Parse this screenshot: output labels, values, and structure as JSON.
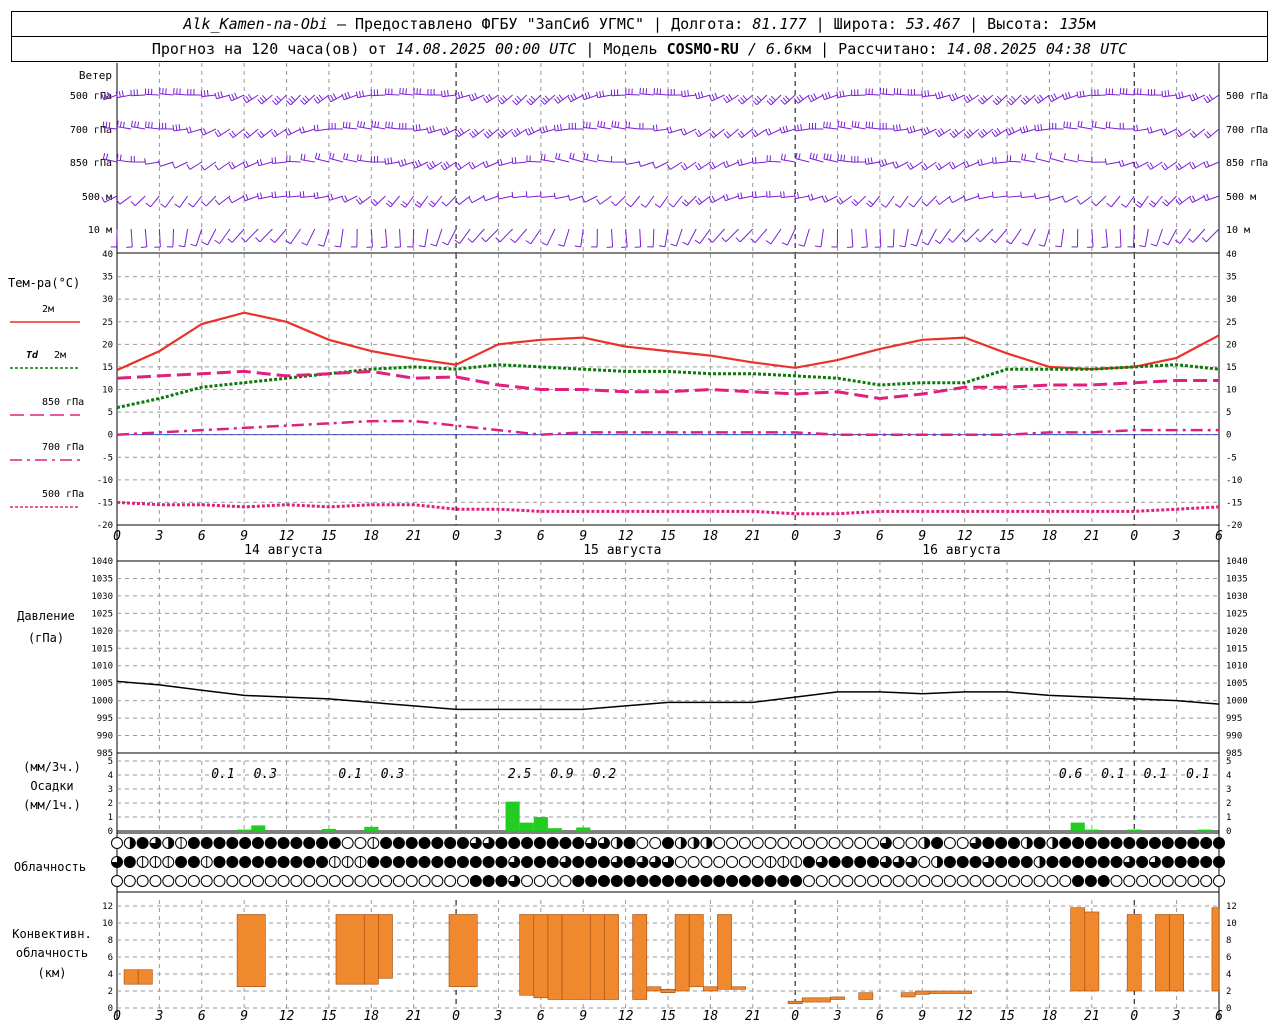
{
  "header": {
    "station": "Alk_Kamen-na-Obi",
    "provider": "– Предоставлено ФГБУ \"ЗапСиб УГМС\" |",
    "lon_label": "Долгота:",
    "lon": "81.177",
    "lat_label": "| Широта:",
    "lat": "53.467",
    "alt_label": "| Высота:",
    "alt": "135",
    "alt_unit": "м",
    "fc_label": "Прогноз на 120 часа(ов) от",
    "fc_start": "14.08.2025 00:00 UTC",
    "model_label": "| Модель",
    "model": "COSMO-RU",
    "model_res": "/ 6.6",
    "model_res_unit": "км",
    "calc_label": "| Рассчитано:",
    "calc_time": "14.08.2025 04:38 UTC"
  },
  "labels": {
    "wind": "Ветер",
    "wind_levels": [
      "500 гПа",
      "700 гПа",
      "850 гПа",
      "500 м",
      "10  м"
    ],
    "temp_title": "Тем-ра(°C)",
    "temp_2m": "2м",
    "td": "Td",
    "td_2m": "2м",
    "t850": "850 гПа",
    "t700": "700 гПа",
    "t500": "500 гПа",
    "pressure": "Давление",
    "pressure_unit": "(гПа)",
    "precip_unit3": "(мм/3ч.)",
    "precip": "Осадки",
    "precip_unit1": "(мм/1ч.)",
    "cloud": "Облачность",
    "conv1": "Конвективн.",
    "conv2": "облачность",
    "conv3": "(км)"
  },
  "colors": {
    "t2m": "#e8322a",
    "td": "#0a7a0a",
    "t850": "#e0207c",
    "wind": "#7a1fd6",
    "precip": "#22cc22",
    "conv": "#f0882e",
    "grid": "#999999"
  },
  "chart_data": [
    {
      "type": "line",
      "title": "Температура",
      "x_ticks": [
        "0",
        "3",
        "6",
        "9",
        "12",
        "15",
        "18",
        "21",
        "0",
        "3",
        "6",
        "9",
        "12",
        "15",
        "18",
        "21",
        "0",
        "3",
        "6",
        "9",
        "12",
        "15",
        "18",
        "21",
        "0",
        "3",
        "6"
      ],
      "day_labels": [
        "14 августа",
        "15 августа",
        "16 августа"
      ],
      "ylim": [
        -20,
        40
      ],
      "yticks": [
        "-20",
        "-15",
        "-10",
        "-5",
        "0",
        "5",
        "10",
        "15",
        "20",
        "25",
        "30",
        "35",
        "40"
      ],
      "x_hours": [
        0,
        3,
        6,
        9,
        12,
        15,
        18,
        21,
        24,
        27,
        30,
        33,
        36,
        39,
        42,
        45,
        48,
        51,
        54,
        57,
        60,
        63,
        66,
        69,
        72,
        75,
        78
      ],
      "series": [
        {
          "name": "2м",
          "key": "t2m",
          "values": [
            14.3,
            18.5,
            24.5,
            27,
            25,
            21,
            18.5,
            16.8,
            15.5,
            20,
            21,
            21.5,
            19.5,
            18.5,
            17.5,
            16,
            14.8,
            16.5,
            19,
            21,
            21.5,
            18,
            15,
            14.5,
            15,
            17,
            22
          ]
        },
        {
          "name": "Td 2м",
          "key": "td",
          "values": [
            6,
            8,
            10.5,
            11.5,
            12.5,
            13.5,
            14.5,
            15,
            14.5,
            15.5,
            15,
            14.5,
            14,
            14,
            13.5,
            13.5,
            13,
            12.5,
            11,
            11.5,
            11.5,
            14.5,
            14.5,
            14.5,
            15,
            15.5,
            14.5
          ]
        },
        {
          "name": "850 гПа",
          "key": "t850",
          "values": [
            12.5,
            13,
            13.5,
            14,
            13,
            13.5,
            14,
            12.5,
            12.8,
            11,
            10,
            10,
            9.5,
            9.5,
            10,
            9.5,
            9,
            9.5,
            8,
            9,
            10.5,
            10.5,
            11,
            11,
            11.5,
            12,
            12
          ]
        },
        {
          "name": "700 гПа",
          "key": "t700",
          "values": [
            0,
            0.5,
            1,
            1.5,
            2,
            2.5,
            3,
            3,
            2,
            1,
            0,
            0.5,
            0.5,
            0.5,
            0.5,
            0.5,
            0.5,
            0,
            0,
            0,
            0,
            0,
            0.5,
            0.5,
            1,
            1,
            1
          ]
        },
        {
          "name": "500 гПа",
          "key": "t500",
          "values": [
            -15,
            -15.5,
            -15.5,
            -16,
            -15.5,
            -16,
            -15.5,
            -15.5,
            -16.5,
            -16.5,
            -17,
            -17,
            -17,
            -17,
            -17,
            -17,
            -17.5,
            -17.5,
            -17,
            -17,
            -17,
            -17,
            -17,
            -17,
            -17,
            -16.5,
            -16
          ]
        }
      ]
    },
    {
      "type": "line",
      "title": "Давление",
      "ylim": [
        985,
        1040
      ],
      "yticks": [
        "985",
        "990",
        "995",
        "1000",
        "1005",
        "1010",
        "1015",
        "1020",
        "1025",
        "1030",
        "1035",
        "1040"
      ],
      "x_hours": [
        0,
        3,
        6,
        9,
        12,
        15,
        18,
        21,
        24,
        27,
        30,
        33,
        36,
        39,
        42,
        45,
        48,
        51,
        54,
        57,
        60,
        63,
        66,
        69,
        72,
        75,
        78
      ],
      "values": [
        1005.5,
        1004.5,
        1003,
        1001.5,
        1001,
        1000.5,
        999.5,
        998.5,
        997.5,
        997.5,
        997.5,
        997.5,
        998.5,
        999.5,
        999.5,
        999.5,
        1001,
        1002.5,
        1002.5,
        1002,
        1002.5,
        1002.5,
        1001.5,
        1001,
        1000.5,
        1000,
        999
      ]
    },
    {
      "type": "bar",
      "title": "Осадки",
      "ylim": [
        0,
        5
      ],
      "yticks": [
        "0",
        "1",
        "2",
        "3",
        "4",
        "5"
      ],
      "bars_1h": [
        [
          9,
          0.1
        ],
        [
          10,
          0.4
        ],
        [
          15,
          0.15
        ],
        [
          18,
          0.3
        ],
        [
          28,
          2.1
        ],
        [
          29,
          0.6
        ],
        [
          30,
          1.0
        ],
        [
          31,
          0.2
        ],
        [
          33,
          0.25
        ],
        [
          68,
          0.6
        ],
        [
          69,
          0.1
        ],
        [
          72,
          0.1
        ],
        [
          77,
          0.1
        ]
      ],
      "totals_3h": [
        {
          "h": 7.5,
          "v": "0.1"
        },
        {
          "h": 10.5,
          "v": "0.3"
        },
        {
          "h": 16.5,
          "v": "0.1"
        },
        {
          "h": 19.5,
          "v": "0.3"
        },
        {
          "h": 28.5,
          "v": "2.5"
        },
        {
          "h": 31.5,
          "v": "0.9"
        },
        {
          "h": 34.5,
          "v": "0.2"
        },
        {
          "h": 67.5,
          "v": "0.6"
        },
        {
          "h": 70.5,
          "v": "0.1"
        },
        {
          "h": 73.5,
          "v": "0.1"
        },
        {
          "h": 76.5,
          "v": "0.1"
        }
      ]
    },
    {
      "type": "table",
      "title": "Облачность",
      "rows": [
        "024321444444444444001444444433444444433240042220000000000000300240034442424444444444444",
        "341114414444444441114444444444434443444343330000000111434444333024443444244444434344444",
        "000000000000000000000000000044430000444444444444444444000000000000000000000444000000000"
      ]
    },
    {
      "type": "bar",
      "title": "Конвективн. облачность",
      "ylim": [
        0,
        12
      ],
      "yticks": [
        "0",
        "2",
        "4",
        "6",
        "8",
        "10",
        "12"
      ],
      "bars": [
        [
          0.5,
          1.5,
          2.8,
          4.5
        ],
        [
          1.5,
          2.5,
          2.8,
          4.5
        ],
        [
          8.5,
          10.5,
          2.5,
          11
        ],
        [
          15.5,
          17.5,
          2.8,
          11
        ],
        [
          17.5,
          18.5,
          2.8,
          11
        ],
        [
          18.5,
          19.5,
          3.5,
          11
        ],
        [
          23.5,
          25.5,
          2.5,
          11
        ],
        [
          28.5,
          29.5,
          1.5,
          11
        ],
        [
          29.5,
          30.5,
          1.2,
          11
        ],
        [
          30.5,
          31.5,
          1.0,
          11
        ],
        [
          31.5,
          33.5,
          1.0,
          11
        ],
        [
          33.5,
          34.5,
          1.0,
          11
        ],
        [
          34.5,
          35.5,
          1.0,
          11
        ],
        [
          36.5,
          37.5,
          1.0,
          11
        ],
        [
          37.5,
          38.5,
          2.0,
          2.5
        ],
        [
          38.5,
          39.5,
          1.8,
          2.2
        ],
        [
          39.5,
          40.5,
          2.0,
          11
        ],
        [
          40.5,
          41.5,
          2.5,
          11
        ],
        [
          41.5,
          42.5,
          2.0,
          2.5
        ],
        [
          42.5,
          43.5,
          2.2,
          11
        ],
        [
          43.5,
          44.5,
          2.2,
          2.5
        ],
        [
          47.5,
          48.5,
          0.5,
          0.8
        ],
        [
          48.5,
          50.5,
          0.7,
          1.2
        ],
        [
          50.5,
          51.5,
          1.0,
          1.3
        ],
        [
          52.5,
          53.5,
          1.0,
          1.8
        ],
        [
          55.5,
          56.5,
          1.3,
          1.8
        ],
        [
          56.5,
          57.5,
          1.6,
          2.0
        ],
        [
          57.5,
          60.5,
          1.7,
          2.0
        ],
        [
          67.5,
          68.5,
          2.0,
          11.8
        ],
        [
          68.5,
          69.5,
          2.0,
          11.3
        ],
        [
          71.5,
          72.5,
          2.0,
          11
        ],
        [
          73.5,
          74.5,
          2.0,
          11
        ],
        [
          74.5,
          75.5,
          2.0,
          11
        ],
        [
          77.5,
          78,
          2.0,
          11.8
        ]
      ]
    }
  ]
}
